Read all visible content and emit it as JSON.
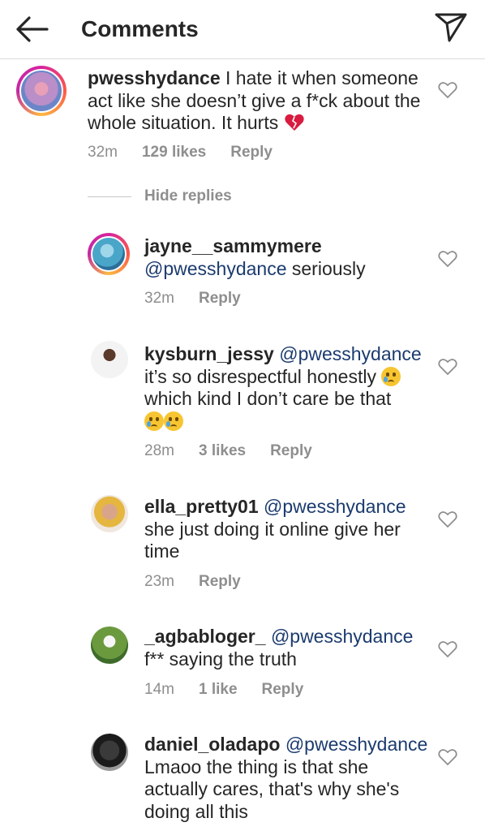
{
  "header": {
    "title": "Comments"
  },
  "colors": {
    "mention": "#1b3b6f",
    "meta": "#8e8e8e",
    "text": "#262626"
  },
  "hide_replies": "Hide replies",
  "reply_label": "Reply",
  "comments": [
    {
      "username": "pwesshydance",
      "text": " I hate it when someone act like she doesn’t give a f*ck about the whole situation. It hurts ",
      "emoji": "broken-heart-icon",
      "time": "32m",
      "likes": "129 likes"
    },
    {
      "username": "jayne__sammymere",
      "mention": "@pwesshydance",
      "text": " seriously",
      "time": "32m",
      "likes": ""
    },
    {
      "username": "kysburn_jessy",
      "mention": "@pwesshydance",
      "text_line1": "it’s so disrespectful honestly ",
      "text_line2": "which kind I don’t care be that",
      "emoji": "crying-face-icon",
      "time": "28m",
      "likes": "3 likes"
    },
    {
      "username": "ella_pretty01",
      "mention": "@pwesshydance",
      "text": "she just doing it online give her time",
      "time": "23m",
      "likes": ""
    },
    {
      "username": "_agbabloger_",
      "mention": "@pwesshydance",
      "text": "f** saying the truth",
      "time": "14m",
      "likes": "1 like"
    },
    {
      "username": "daniel_oladapo",
      "mention": "@pwesshydance",
      "text": "Lmaoo the thing is that she actually cares, that's why she's doing all this",
      "time": "",
      "likes": ""
    }
  ]
}
